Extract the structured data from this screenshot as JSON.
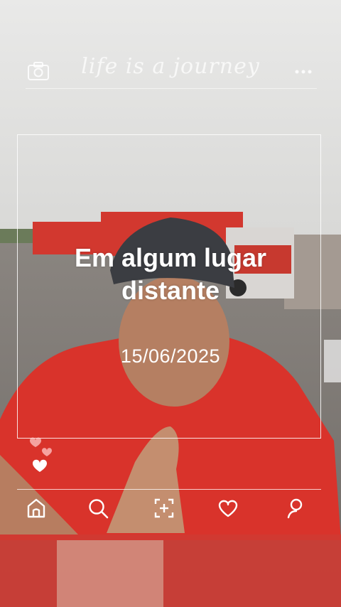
{
  "header": {
    "camera_icon": "camera-icon",
    "brand_text": "life is a journey",
    "more_icon": "more-dots-icon"
  },
  "post": {
    "headline": "Em algum lugar distante",
    "date": "15/06/2025"
  },
  "reactions": {
    "icon": "heart-icon"
  },
  "bottom_nav": {
    "items": [
      {
        "icon": "home-icon"
      },
      {
        "icon": "search-icon"
      },
      {
        "icon": "add-post-icon"
      },
      {
        "icon": "heart-icon"
      },
      {
        "icon": "profile-icon"
      }
    ]
  },
  "colors": {
    "overlay_white": "#ffffff",
    "shirt_red": "#d9332b",
    "truck_red": "#d2382f"
  }
}
